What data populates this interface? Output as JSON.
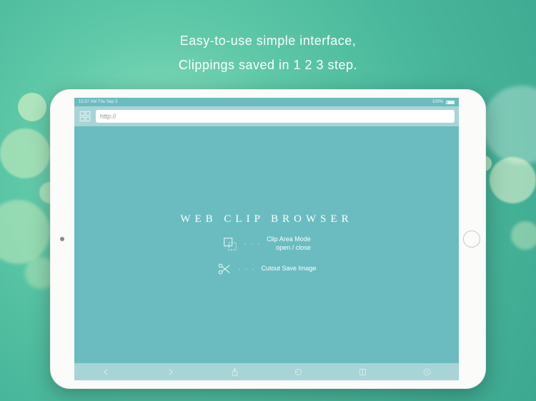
{
  "headline": {
    "line1": "Easy-to-use simple interface,",
    "line2": "Clippings saved in 1 2 3 step."
  },
  "status": {
    "time_date": "10:37 AM  Thu Sep 5",
    "battery": "100%"
  },
  "url_bar": {
    "value": "http://"
  },
  "content": {
    "app_title": "WEB CLIP BROWSER",
    "feature1_line1": "Clip Area Mode",
    "feature1_line2": "open / close",
    "feature2": "Cutout Save Image",
    "dots": "· · ·"
  },
  "toolbar": {
    "back": "back",
    "forward": "forward",
    "share": "share",
    "refresh": "refresh",
    "book": "book",
    "stop": "stop"
  }
}
